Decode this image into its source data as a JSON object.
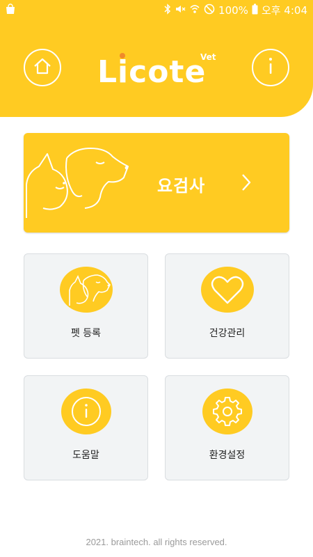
{
  "status_bar": {
    "battery_percent": "100%",
    "time": "오후 4:04"
  },
  "header": {
    "logo_text": "Licote",
    "logo_sub": "Vet",
    "home_icon": "home-icon",
    "info_icon": "info-icon",
    "color": "#FFCB22"
  },
  "urine_test": {
    "label": "요검사",
    "icon": "dog-cat-outline-icon"
  },
  "menu": {
    "pet_register": "펫 등록",
    "health_manage": "건강관리",
    "help": "도움말",
    "settings": "환경설정"
  },
  "footer": {
    "copyright": "2021. braintech. all rights reserved."
  }
}
